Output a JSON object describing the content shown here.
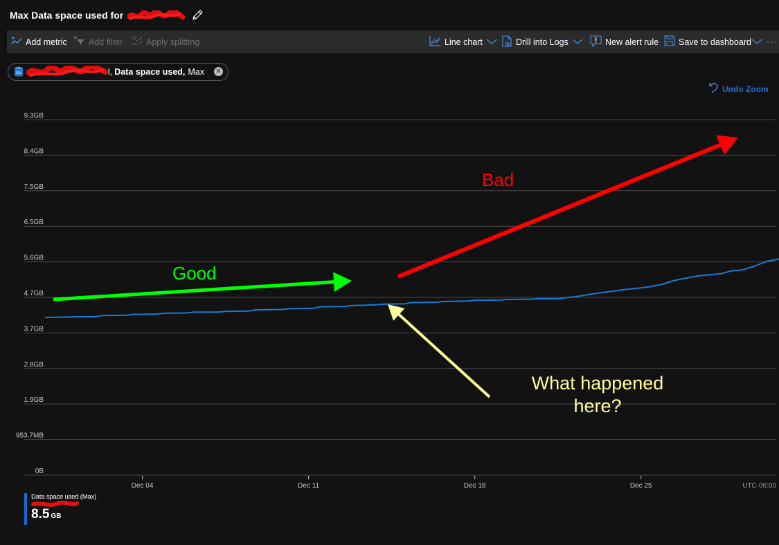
{
  "header": {
    "title": "Max Data space used for",
    "title_redacted": true
  },
  "toolbar": {
    "left": [
      {
        "label": "Add metric",
        "icon": "add-metric-icon",
        "enabled": true
      },
      {
        "label": "Add filter",
        "icon": "add-filter-icon",
        "enabled": false
      },
      {
        "label": "Apply splitting",
        "icon": "apply-splitting-icon",
        "enabled": false
      }
    ],
    "right": [
      {
        "label": "Line chart",
        "icon": "line-chart-icon",
        "dropdown": true
      },
      {
        "label": "Drill into Logs",
        "icon": "drill-logs-icon",
        "dropdown": true
      },
      {
        "label": "New alert rule",
        "icon": "alert-rule-icon",
        "dropdown": false
      },
      {
        "label": "Save to dashboard",
        "icon": "save-icon",
        "dropdown": true
      }
    ],
    "more_label": "···"
  },
  "metric_pill": {
    "resource_icon": "sql-database-icon",
    "resource_suffix": "l,",
    "metric": "Data space used,",
    "aggregation": "Max",
    "close_glyph": "✕"
  },
  "undo_zoom": {
    "label": "Undo Zoom",
    "icon": "undo-icon"
  },
  "legend": {
    "title": "Data space used (Max)",
    "value": "8.5",
    "unit": "GB",
    "color": "#0f6cd0"
  },
  "colors": {
    "series": "#1a7ad4",
    "good": "#00ff00",
    "bad": "#ff0000",
    "question": "#ffff99",
    "grid": "#4a4a4a"
  },
  "chart_data": {
    "type": "line",
    "title": "Max Data space used",
    "xlabel": "",
    "ylabel": "",
    "timezone_label": "UTC-06:00",
    "y_ticks": [
      "0B",
      "953.7MB",
      "1.9GB",
      "2.8GB",
      "3.7GB",
      "4.7GB",
      "5.6GB",
      "6.5GB",
      "7.5GB",
      "8.4GB",
      "9.3GB"
    ],
    "y_tick_values_gb": [
      0,
      0.931,
      1.863,
      2.794,
      3.725,
      4.657,
      5.588,
      6.519,
      7.451,
      8.382,
      9.313
    ],
    "ylim_gb": [
      0,
      9.313
    ],
    "x_ticks": [
      {
        "label": "Dec 04",
        "day": 4
      },
      {
        "label": "Dec 11",
        "day": 11
      },
      {
        "label": "Dec 18",
        "day": 18
      },
      {
        "label": "Dec 25",
        "day": 25
      }
    ],
    "xlim_days": [
      -0.4,
      34.0
    ],
    "grid": true,
    "legend_position": "bottom-left",
    "series": [
      {
        "name": "Data space used (Max)",
        "unit": "GB",
        "points": [
          [
            -0.1,
            4.13
          ],
          [
            0.6,
            4.14
          ],
          [
            1.4,
            4.15
          ],
          [
            2.0,
            4.15
          ],
          [
            2.3,
            4.18
          ],
          [
            3.3,
            4.19
          ],
          [
            3.6,
            4.21
          ],
          [
            4.6,
            4.22
          ],
          [
            4.9,
            4.24
          ],
          [
            5.9,
            4.25
          ],
          [
            6.2,
            4.27
          ],
          [
            7.2,
            4.27
          ],
          [
            7.5,
            4.29
          ],
          [
            8.5,
            4.3
          ],
          [
            8.8,
            4.33
          ],
          [
            9.9,
            4.34
          ],
          [
            10.2,
            4.36
          ],
          [
            11.2,
            4.37
          ],
          [
            11.5,
            4.41
          ],
          [
            12.5,
            4.42
          ],
          [
            12.8,
            4.44
          ],
          [
            13.8,
            4.46
          ],
          [
            14.2,
            4.48
          ],
          [
            15.1,
            4.49
          ],
          [
            15.3,
            4.52
          ],
          [
            16.4,
            4.53
          ],
          [
            16.7,
            4.55
          ],
          [
            17.7,
            4.56
          ],
          [
            18.0,
            4.58
          ],
          [
            19.1,
            4.59
          ],
          [
            19.3,
            4.6
          ],
          [
            20.4,
            4.61
          ],
          [
            20.6,
            4.62
          ],
          [
            21.5,
            4.62
          ],
          [
            22.0,
            4.66
          ],
          [
            22.2,
            4.67
          ],
          [
            22.6,
            4.71
          ],
          [
            23.1,
            4.76
          ],
          [
            23.7,
            4.81
          ],
          [
            24.3,
            4.86
          ],
          [
            24.9,
            4.9
          ],
          [
            25.4,
            4.94
          ],
          [
            25.9,
            5.0
          ],
          [
            26.4,
            5.1
          ],
          [
            26.9,
            5.16
          ],
          [
            27.4,
            5.22
          ],
          [
            27.9,
            5.25
          ],
          [
            28.4,
            5.28
          ],
          [
            28.8,
            5.35
          ],
          [
            29.3,
            5.38
          ],
          [
            29.8,
            5.48
          ],
          [
            30.3,
            5.6
          ],
          [
            30.8,
            5.66
          ],
          [
            31.3,
            5.74
          ],
          [
            31.8,
            5.76
          ],
          [
            32.3,
            5.86
          ],
          [
            32.8,
            5.91
          ],
          [
            33.3,
            6.0
          ],
          [
            33.8,
            6.03
          ],
          [
            34.3,
            6.1
          ]
        ]
      }
    ],
    "annotations": [
      {
        "text": "Good",
        "color": "#00ff00",
        "type": "arrow",
        "direction": "right-slightly-up"
      },
      {
        "text": "Bad",
        "color": "#ff0000",
        "type": "arrow",
        "direction": "up-right-steep"
      },
      {
        "text": "What happened here?",
        "color": "#ffff99",
        "type": "arrow",
        "direction": "up-left",
        "points_to_day": 13.0
      }
    ]
  }
}
